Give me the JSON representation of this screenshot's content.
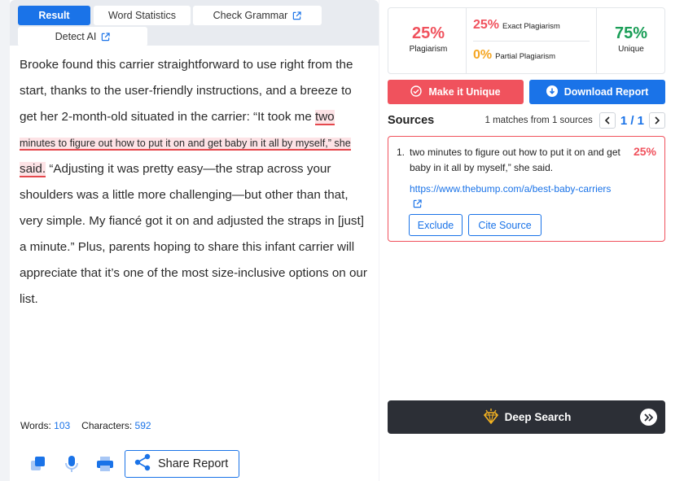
{
  "tabs": {
    "result": "Result",
    "word_statistics": "Word Statistics",
    "check_grammar": "Check Grammar",
    "detect_ai": "Detect AI"
  },
  "essay": {
    "part1": "Brooke found this carrier straightforward to use right from the start, thanks to the user-friendly instructions, and a breeze to get her 2-month-old situated in the carrier: “It took me ",
    "highlight_a": "two",
    "highlight_b": "minutes to figure out how to put it on and get baby in it all by myself,” she",
    "highlight_c": "said.",
    "part2": " “Adjusting it was pretty easy—the strap across your shoulders was a little more challenging—but other than that, very simple. My fiancé got it on and adjusted the straps in [just] a minute.” Plus, parents hoping to share this infant carrier will appreciate that it’s one of the most size-inclusive options on our list."
  },
  "counts": {
    "words_label": "Words:",
    "words_value": "103",
    "chars_label": "Characters:",
    "chars_value": "592"
  },
  "toolbar": {
    "share_label": "Share Report",
    "icons": [
      "copy-icon",
      "microphone-icon",
      "print-icon",
      "share-icon"
    ]
  },
  "stats": {
    "plagiarism_pct": "25%",
    "plagiarism_label": "Plagiarism",
    "exact_pct": "25%",
    "exact_label": "Exact Plagiarism",
    "partial_pct": "0%",
    "partial_label": "Partial Plagiarism",
    "unique_pct": "75%",
    "unique_label": "Unique"
  },
  "actions": {
    "make_unique": "Make it Unique",
    "download_report": "Download Report"
  },
  "sources": {
    "title": "Sources",
    "matches_text": "1 matches from 1 sources",
    "pager": "1 / 1",
    "items": [
      {
        "num": "1.",
        "text": "two minutes to figure out how to put it on and get baby in it all by myself,” she said.",
        "pct": "25%",
        "url": "https://www.thebump.com/a/best-baby-carriers",
        "exclude": "Exclude",
        "cite": "Cite Source"
      }
    ]
  },
  "deep_search": {
    "label": "Deep Search"
  },
  "colors": {
    "accent": "#1a73e8",
    "danger": "#f0525d",
    "success": "#1a9e57",
    "partial": "#f5a623",
    "dark": "#2c2f36"
  }
}
